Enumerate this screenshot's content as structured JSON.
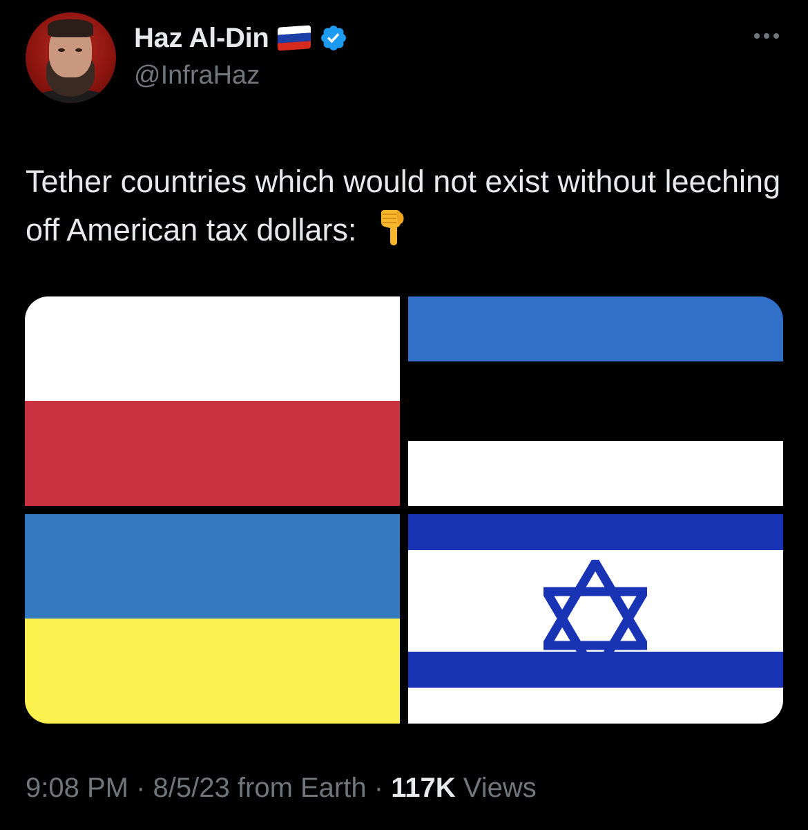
{
  "author": {
    "display_name": "Haz Al-Din",
    "handle": "@InfraHaz",
    "flag_icon": "russia-flag-icon",
    "verified_icon": "verified-badge-icon",
    "verified_color": "#1d9bf0"
  },
  "more_icon": "more-options-icon",
  "tweet": {
    "text": "Tether countries which would not exist without leeching off American tax dollars:",
    "emoji": "👇",
    "emoji_icon": "pointing-down-hand-icon"
  },
  "media": {
    "flags": [
      {
        "name": "poland-flag",
        "colors": [
          "#ffffff",
          "#ca3240"
        ]
      },
      {
        "name": "estonia-flag",
        "colors": [
          "#3070c8",
          "#000000",
          "#ffffff"
        ]
      },
      {
        "name": "ukraine-flag",
        "colors": [
          "#357ac0",
          "#fbf250"
        ]
      },
      {
        "name": "israel-flag",
        "colors": [
          "#ffffff",
          "#1833b4"
        ]
      }
    ]
  },
  "meta": {
    "time": "9:08 PM",
    "date": "8/5/23",
    "source": "from Earth",
    "separator": "·",
    "views_count": "117K",
    "views_label": "Views"
  },
  "colors": {
    "background": "#000000",
    "primary_text": "#e7e9ea",
    "secondary_text": "#71767b"
  }
}
